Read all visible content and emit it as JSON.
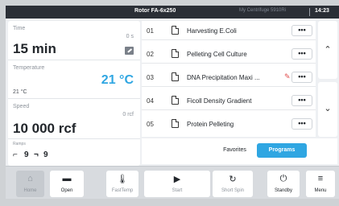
{
  "header": {
    "rotor": "Rotor FA-6x250",
    "device": "My Centrifuge 5910Ri",
    "clock": "14:23"
  },
  "params": {
    "time": {
      "label": "Time",
      "value": "15 min",
      "setpoint": "0 s"
    },
    "temperature": {
      "label": "Temperature",
      "value": "21 °C",
      "current": "21 °C"
    },
    "speed": {
      "label": "Speed",
      "value": "10 000 rcf",
      "current": "0 rcf"
    },
    "ramps": {
      "label": "Ramps",
      "up": "9",
      "down": "9"
    }
  },
  "programs": [
    {
      "num": "01",
      "name": "Harvesting E.Coli",
      "more": "•••"
    },
    {
      "num": "02",
      "name": "Pelleting Cell Culture",
      "more": "•••"
    },
    {
      "num": "03",
      "name": "DNA Precipitation Maxi ...",
      "more": "•••"
    },
    {
      "num": "04",
      "name": "Ficoll Density Gradient",
      "more": "•••"
    },
    {
      "num": "05",
      "name": "Protein Pelleting",
      "more": "•••"
    }
  ],
  "tabs": {
    "favorites": "Favorites",
    "programs": "Programs"
  },
  "bottom": {
    "home": "Home",
    "open": "Open",
    "fasttemp": "FastTemp",
    "start": "Start",
    "shortspin": "Short Spin",
    "standby": "Standby",
    "menu": "Menu"
  },
  "icons": {
    "home": "home-icon",
    "open": "folder-icon",
    "fasttemp": "thermometer-icon",
    "start": "play-icon",
    "shortspin": "refresh-icon",
    "standby": "power-icon",
    "menu": "hamburger-icon",
    "edit": "edit-icon",
    "flag": "pen-flag-icon"
  },
  "colors": {
    "accent": "#2fa6e2",
    "header": "#2b2f36",
    "flag": "#e04b4b"
  }
}
